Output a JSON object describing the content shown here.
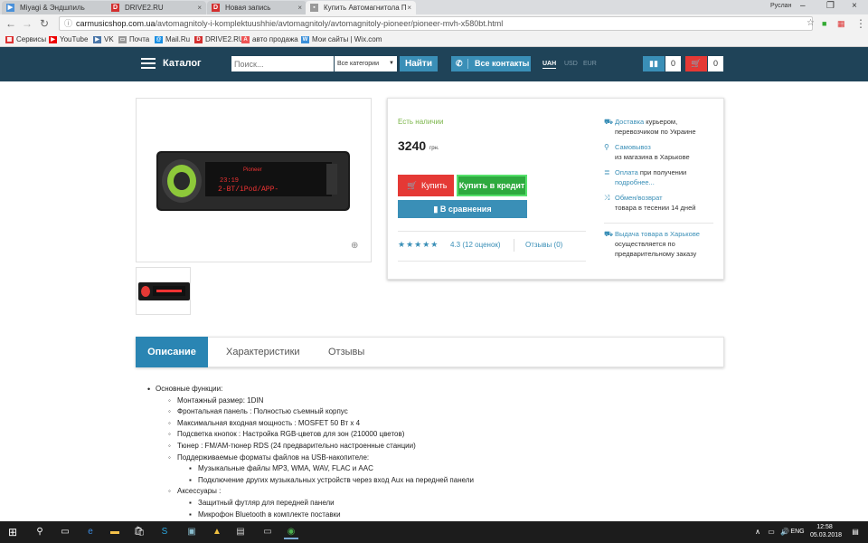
{
  "browser": {
    "tabs": [
      {
        "title": "Miyagi & Эндшпиль",
        "icon": "media-icon",
        "color": "#4a90d9"
      },
      {
        "title": "DRIVE2.RU",
        "icon": "drive2-icon",
        "color": "#d32f2f"
      },
      {
        "title": "Новая запись",
        "icon": "drive2-icon",
        "color": "#d32f2f"
      },
      {
        "title": "Купить Автомагнитола П",
        "icon": "page-icon",
        "color": "#888888"
      }
    ],
    "profile": "Руслан",
    "url_domain": "carmusicshop.com.ua",
    "url_path": "/avtomagnitoly-i-komplektuushhie/avtomagnitoly/avtomagnitoly-pioneer/pioneer-mvh-x580bt.html",
    "bookmarks": [
      {
        "label": "Сервисы",
        "icon": "apps-icon",
        "color": "#d33"
      },
      {
        "label": "YouTube",
        "icon": "youtube-icon",
        "color": "#e00"
      },
      {
        "label": "VK",
        "icon": "vk-icon",
        "color": "#4a76a8"
      },
      {
        "label": "Почта",
        "icon": "folder-icon",
        "color": "#888"
      },
      {
        "label": "Mail.Ru",
        "icon": "mailru-icon",
        "color": "#168de2"
      },
      {
        "label": "DRIVE2.RU",
        "icon": "drive2-icon",
        "color": "#d32f2f"
      },
      {
        "label": "авто продажа",
        "icon": "auto-icon",
        "color": "#e55"
      },
      {
        "label": "Мои сайты | Wix.com",
        "icon": "wix-icon",
        "color": "#3a8fd9"
      }
    ]
  },
  "header": {
    "catalog": "Каталог",
    "search_placeholder": "Поиск...",
    "categories": "Все категории",
    "find": "Найти",
    "contacts": "Все контакты",
    "currencies": [
      "UAH",
      "USD",
      "EUR"
    ],
    "compare_count": "0",
    "cart_count": "0"
  },
  "product": {
    "in_stock": "Есть наличии",
    "price": "3240",
    "price_currency": "грн.",
    "buy": "Купить",
    "credit": "Купить в кредит",
    "compare": "В сравнения",
    "rating_value": 4.3,
    "rating": "4.3 (12 оценок)",
    "reviews": "Отзывы (0)",
    "info": [
      {
        "link": "Доставка",
        "text": " курьером, перевозчиком по Украине",
        "icon": "truck-icon"
      },
      {
        "link": "Самовывоз",
        "text": " из магазина в Харькове",
        "icon": "pin-icon"
      },
      {
        "link": "Оплата",
        "text": "  при получении ",
        "extra": "подробнее...",
        "icon": "coins-icon"
      },
      {
        "link": "Обмен/возврат",
        "text": " товара в тесении 14 дней",
        "icon": "shuffle-icon"
      },
      {
        "link": "Выдача товара в Харькове",
        "text": " осуществляется по предварительному заказу",
        "icon": "truck-icon"
      }
    ]
  },
  "tabs": [
    "Описание",
    "Характеристики",
    "Отзывы"
  ],
  "description": {
    "main": "Основные функции:",
    "items": [
      "Монтажный размер: 1DIN",
      "Фронтальная панель : Полностью съемный корпус",
      "Максимальная входная мощность : MOSFET 50 Вт х 4",
      "Подсветка кнопок : Настройка RGB-цветов для зон (210000 цветов)",
      "Тюнер : FM/AM-тюнер RDS (24 предварительно настроенные станции)",
      "Поддерживаемые форматы файлов на USB-накопителе:"
    ],
    "usb": [
      "Музыкальные файлы MP3, WMA, WAV, FLAC и AAC",
      "Подключение других музыкальных устройств через вход Aux на передней панели"
    ],
    "accessories": "Аксессуары :",
    "acc_items": [
      "Защитный футляр для передней панели",
      "Микрофон Bluetooth в комплекте поставки"
    ]
  },
  "taskbar": {
    "lang": "ENG",
    "time": "12:58",
    "date": "05.03.2018"
  }
}
